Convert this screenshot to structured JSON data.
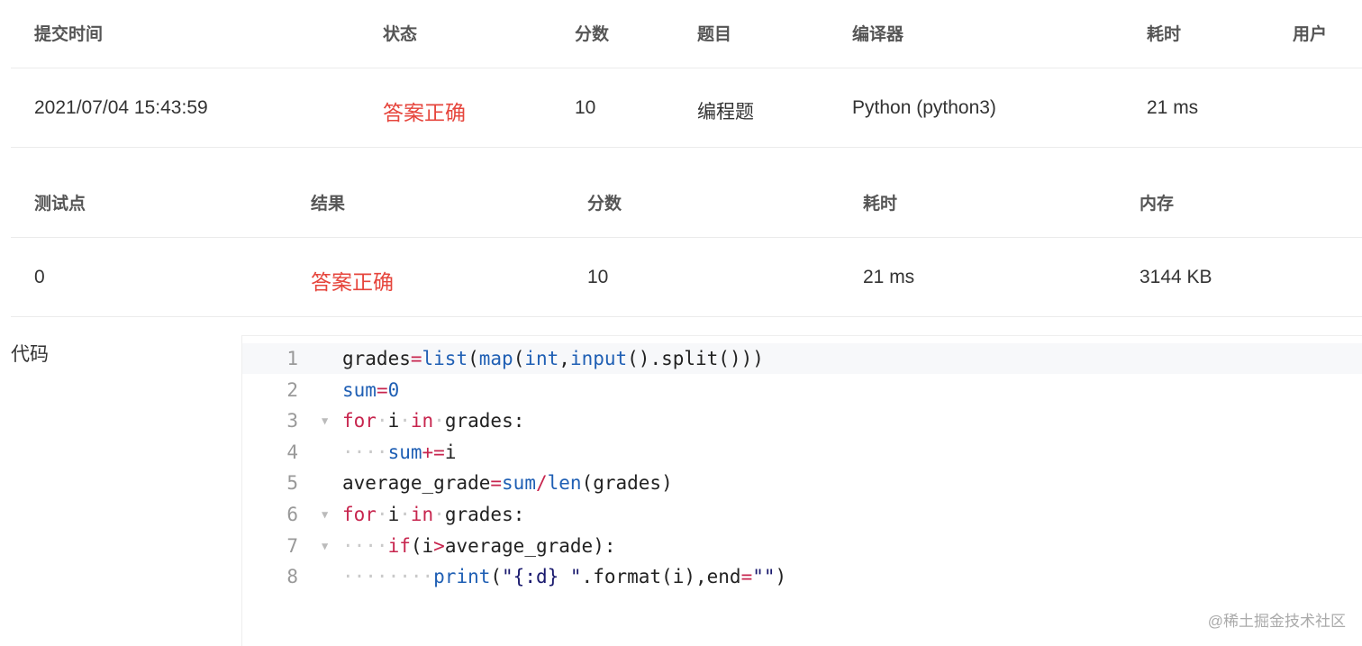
{
  "submission": {
    "headers": [
      "提交时间",
      "状态",
      "分数",
      "题目",
      "编译器",
      "耗时",
      "用户"
    ],
    "row": {
      "time": "2021/07/04 15:43:59",
      "status": "答案正确",
      "score": "10",
      "problem": "编程题",
      "compiler": "Python (python3)",
      "duration": "21 ms",
      "user": ""
    }
  },
  "testcases": {
    "headers": [
      "测试点",
      "结果",
      "分数",
      "耗时",
      "内存"
    ],
    "row": {
      "point": "0",
      "result": "答案正确",
      "score": "10",
      "duration": "21 ms",
      "memory": "3144 KB"
    }
  },
  "code_label": "代码",
  "code": {
    "line_numbers": [
      "1",
      "2",
      "3",
      "4",
      "5",
      "6",
      "7",
      "8"
    ],
    "fold_icon": "triangle-down-icon",
    "lines": [
      [
        [
          "t",
          "grades"
        ],
        [
          "op",
          "="
        ],
        [
          "bi",
          "list"
        ],
        [
          "t",
          "("
        ],
        [
          "bi",
          "map"
        ],
        [
          "t",
          "("
        ],
        [
          "bi",
          "int"
        ],
        [
          "t",
          ","
        ],
        [
          "bi",
          "input"
        ],
        [
          "t",
          "().split()))"
        ]
      ],
      [
        [
          "bi",
          "sum"
        ],
        [
          "op",
          "="
        ],
        [
          "num",
          "0"
        ]
      ],
      [
        [
          "kw",
          "for"
        ],
        [
          "dot",
          "·"
        ],
        [
          "t",
          "i"
        ],
        [
          "dot",
          "·"
        ],
        [
          "kw",
          "in"
        ],
        [
          "dot",
          "·"
        ],
        [
          "t",
          "grades:"
        ]
      ],
      [
        [
          "dot",
          "····"
        ],
        [
          "bi",
          "sum"
        ],
        [
          "op",
          "+="
        ],
        [
          "t",
          "i"
        ]
      ],
      [
        [
          "t",
          "average_grade"
        ],
        [
          "op",
          "="
        ],
        [
          "bi",
          "sum"
        ],
        [
          "op",
          "/"
        ],
        [
          "bi",
          "len"
        ],
        [
          "t",
          "(grades)"
        ]
      ],
      [
        [
          "kw",
          "for"
        ],
        [
          "dot",
          "·"
        ],
        [
          "t",
          "i"
        ],
        [
          "dot",
          "·"
        ],
        [
          "kw",
          "in"
        ],
        [
          "dot",
          "·"
        ],
        [
          "t",
          "grades:"
        ]
      ],
      [
        [
          "dot",
          "····"
        ],
        [
          "kw",
          "if"
        ],
        [
          "t",
          "(i"
        ],
        [
          "op",
          ">"
        ],
        [
          "t",
          "average_grade):"
        ]
      ],
      [
        [
          "dot",
          "········"
        ],
        [
          "bi",
          "print"
        ],
        [
          "t",
          "("
        ],
        [
          "str",
          "\"{:d} \""
        ],
        [
          "t",
          ".format(i),end"
        ],
        [
          "op",
          "="
        ],
        [
          "str",
          "\"\""
        ],
        [
          "t",
          ")"
        ]
      ]
    ],
    "foldable_lines": [
      3,
      6,
      7
    ]
  },
  "watermark": "@稀土掘金技术社区",
  "colors": {
    "accent_red": "#e6453c",
    "keyword": "#c7254e",
    "builtin": "#1f5fb4"
  }
}
